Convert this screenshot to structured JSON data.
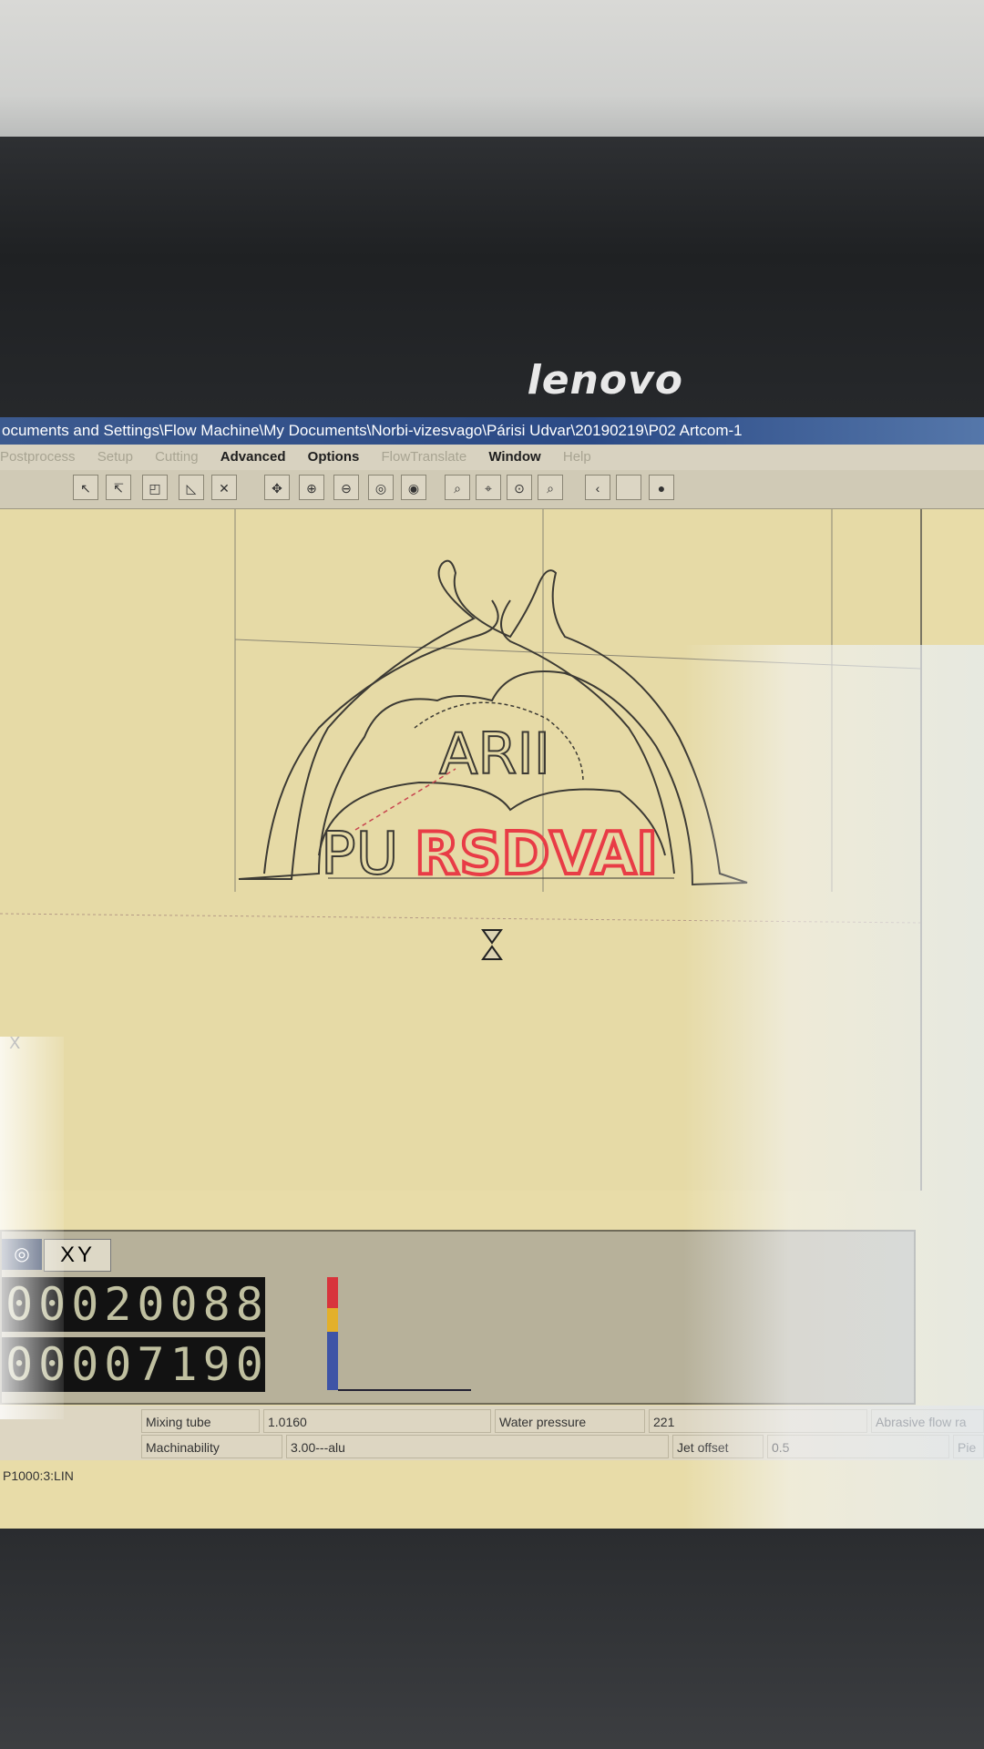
{
  "brand": {
    "logo": "lenovo"
  },
  "window": {
    "title_path": "ocuments and Settings\\Flow Machine\\My Documents\\Norbi-vizesvago\\Párisi Udvar\\20190219\\P02 Artcom-1"
  },
  "menu": {
    "items": [
      {
        "label": "Postprocess",
        "enabled": false
      },
      {
        "label": "Setup",
        "enabled": false
      },
      {
        "label": "Cutting",
        "enabled": false
      },
      {
        "label": "Advanced",
        "enabled": true
      },
      {
        "label": "Options",
        "enabled": true
      },
      {
        "label": "FlowTranslate",
        "enabled": false
      },
      {
        "label": "Window",
        "enabled": true
      },
      {
        "label": "Help",
        "enabled": false
      }
    ]
  },
  "toolbar": {
    "icons": [
      "select-arrow-icon",
      "select-point-icon",
      "select-box-icon",
      "select-chain-icon",
      "delete-icon",
      "pan-icon",
      "zoom-in-icon",
      "zoom-out-icon",
      "zoom-window-icon",
      "zoom-extents-icon",
      "zoom-prev-icon",
      "zoom-all-icon",
      "zoom-part-icon",
      "zoom-select-icon",
      "back-icon",
      "blank-icon",
      "color-icon"
    ]
  },
  "drawing": {
    "text_top": "ARII",
    "text_bottom_black": "PU",
    "text_bottom_red": "RSDVAI",
    "cursor_icon": "hourglass-icon",
    "axis_label": "X"
  },
  "panel": {
    "tab_label": "XY",
    "readout_x": "00020088",
    "readout_y": "00007190"
  },
  "status": {
    "mixing_tube_label": "Mixing tube",
    "mixing_tube_value": "1.0160",
    "water_pressure_label": "Water pressure",
    "water_pressure_value": "221",
    "abrasive_label": "Abrasive flow ra",
    "machinability_label": "Machinability",
    "machinability_value": "3.00---alu",
    "jet_offset_label": "Jet offset",
    "jet_offset_value": "0.5",
    "extra_label": "Pie"
  },
  "statusline": {
    "text": "P1000:3:LIN"
  },
  "colors": {
    "cut_red": "#e83c46",
    "canvas_bg": "#e6daa6",
    "outline": "#3c3a34"
  }
}
